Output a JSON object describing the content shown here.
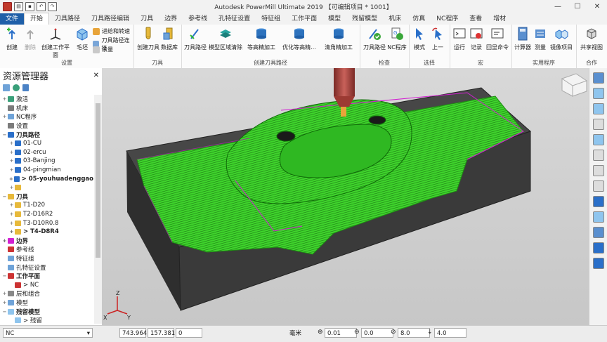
{
  "window": {
    "title": "Autodesk PowerMill Ultimate 2019 【可编辑项目 * 1001】"
  },
  "tabs": [
    "文件",
    "开始",
    "刀具路径",
    "刀具路径编辑",
    "刀具",
    "边界",
    "参考线",
    "孔特征设置",
    "特征组",
    "工作平面",
    "模型",
    "残留模型",
    "机床",
    "仿真",
    "NC程序",
    "查看",
    "增材"
  ],
  "ribbon": {
    "setup": {
      "label": "设置",
      "create": "创建",
      "delete": "删除",
      "workplane": "创建工作平面",
      "block": "毛坯",
      "feeds": "进给和转速",
      "connect": "刀具路径连接",
      "thickness": "余量"
    },
    "tool": {
      "label": "刀具",
      "create": "创建刀具",
      "db": "数据库"
    },
    "create_tp": {
      "label": "创建刀具路径",
      "tp": "刀具路径",
      "area": "模型区域清除",
      "zfinish": "等高精加工",
      "optz": "优化等高精...",
      "corner": "清角精加工"
    },
    "verify": {
      "label": "检查",
      "tp": "刀具路径",
      "nc": "NC程序"
    },
    "select": {
      "label": "选择",
      "mode": "模式",
      "up": "上一"
    },
    "macro": {
      "label": "宏",
      "run": "运行",
      "record": "记录",
      "echo": "回显命令"
    },
    "utility": {
      "label": "实用程序",
      "calc": "计算器",
      "measure": "测量",
      "mirror": "镜像项目"
    },
    "collab": {
      "label": "合作",
      "share": "共享视图"
    }
  },
  "explorer": {
    "title": "资源管理器",
    "items": [
      {
        "label": "激活",
        "exp": "+"
      },
      {
        "label": "机床",
        "exp": ""
      },
      {
        "label": "NC程序",
        "exp": "+"
      },
      {
        "label": "设置",
        "exp": ""
      },
      {
        "label": "刀具路径",
        "exp": "−"
      },
      {
        "label": "01-CU",
        "exp": "+"
      },
      {
        "label": "02-ercu",
        "exp": "+"
      },
      {
        "label": "03-Banjing",
        "exp": "+"
      },
      {
        "label": "04-pingmian",
        "exp": "+"
      },
      {
        "label": "> 05-youhuadenggao",
        "exp": "+"
      },
      {
        "label": "",
        "exp": "+"
      },
      {
        "label": "刀具",
        "exp": "−"
      },
      {
        "label": "T1-D20",
        "exp": "+"
      },
      {
        "label": "T2-D16R2",
        "exp": "+"
      },
      {
        "label": "T3-D10R0.8",
        "exp": "+"
      },
      {
        "label": "> T4-D8R4",
        "exp": "+"
      },
      {
        "label": "边界",
        "exp": "+"
      },
      {
        "label": "参考线",
        "exp": ""
      },
      {
        "label": "特征组",
        "exp": ""
      },
      {
        "label": "孔特征设置",
        "exp": ""
      },
      {
        "label": "工作平面",
        "exp": "−"
      },
      {
        "label": "> NC",
        "exp": ""
      },
      {
        "label": "层和组合",
        "exp": "+"
      },
      {
        "label": "模型",
        "exp": "+"
      },
      {
        "label": "残留模型",
        "exp": "−"
      },
      {
        "label": "> 残留",
        "exp": ""
      }
    ]
  },
  "viewport": {
    "axis_z": "Z",
    "axis_x": "X",
    "axis_y": "Y"
  },
  "status": {
    "workplane": "NC",
    "x": "743.964",
    "y": "157.381",
    "z": "0",
    "units": "毫米",
    "tolerance": "0.01",
    "thickness": "0.0",
    "diameter": "8.0",
    "stepdown": "4.0"
  },
  "colors": {
    "file_tab": "#1f5fa8",
    "toolpath": "#39d12b",
    "block": "#3d3d3d",
    "viewport_bg": "#cfcfcf"
  }
}
